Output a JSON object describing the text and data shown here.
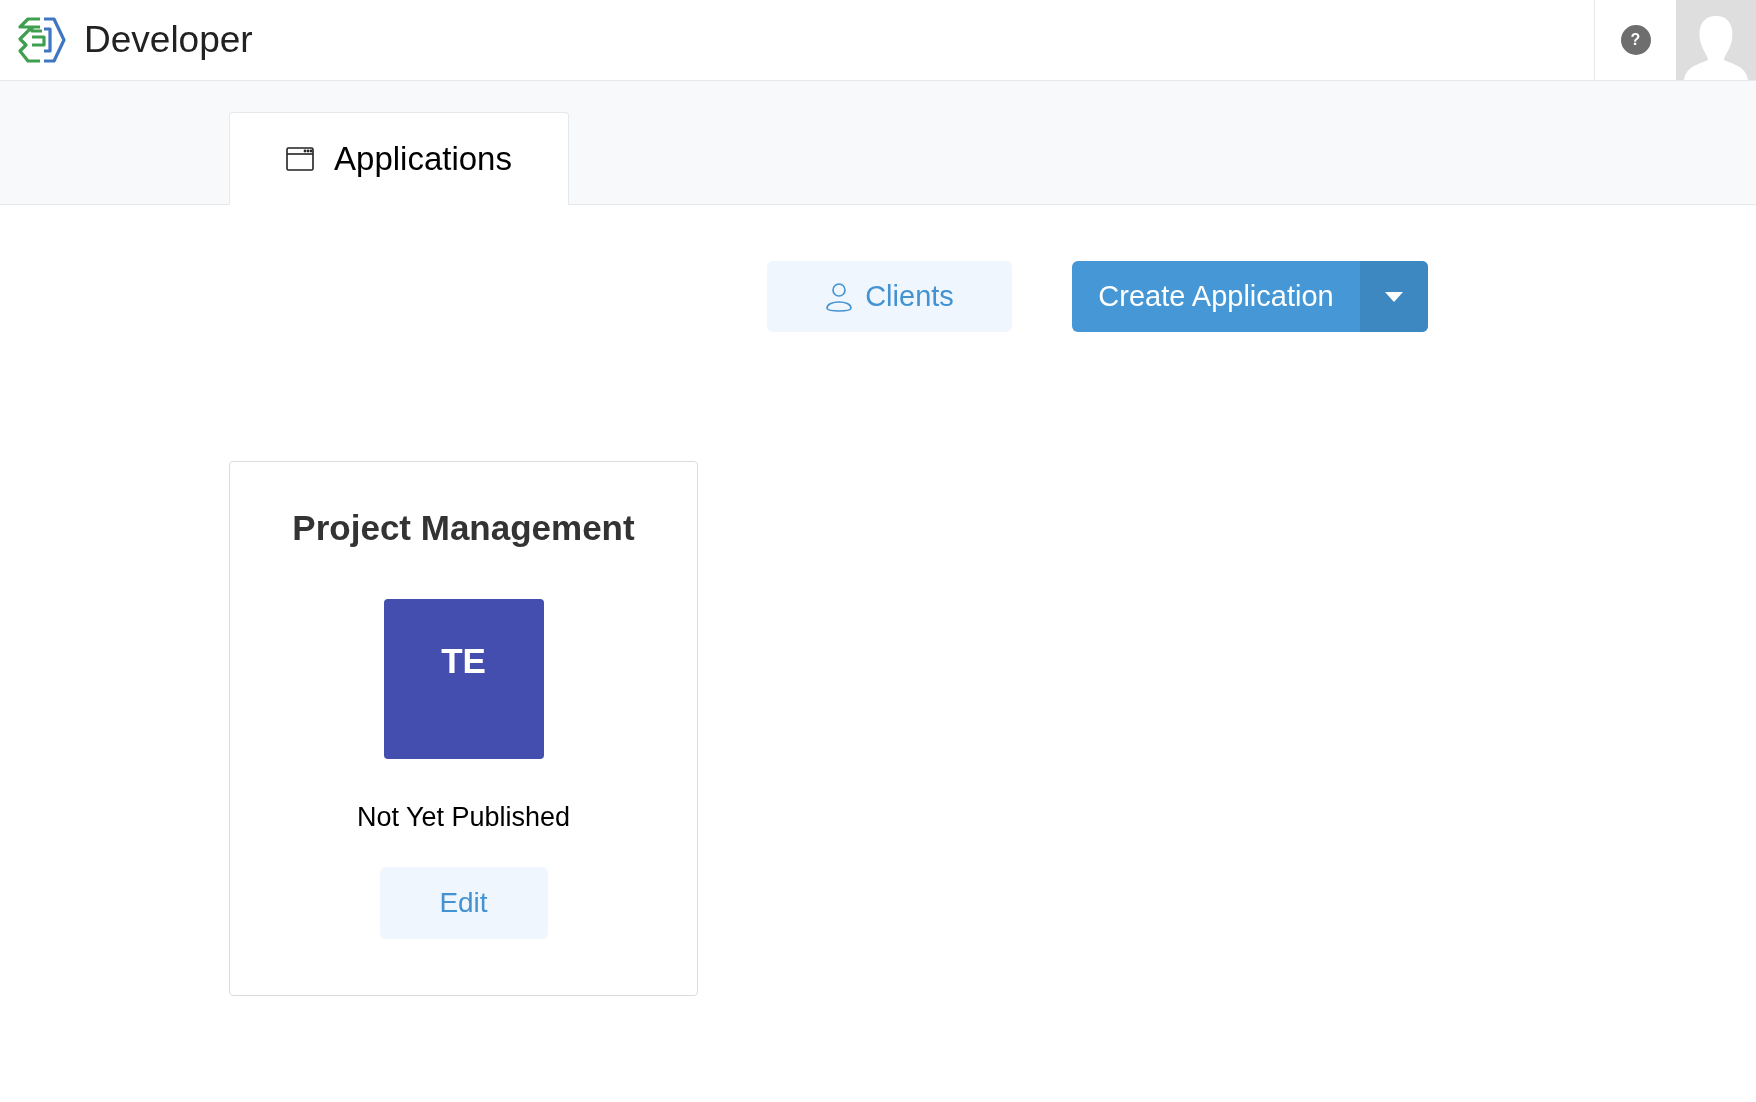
{
  "header": {
    "title": "Developer",
    "help": "?"
  },
  "tabs": [
    {
      "label": "Applications",
      "selected": true
    }
  ],
  "actions": {
    "clients": "Clients",
    "create": "Create Application"
  },
  "apps": [
    {
      "name": "Project Management",
      "initials": "TE",
      "color": "#444eae",
      "status": "Not Yet Published",
      "edit": "Edit"
    }
  ]
}
